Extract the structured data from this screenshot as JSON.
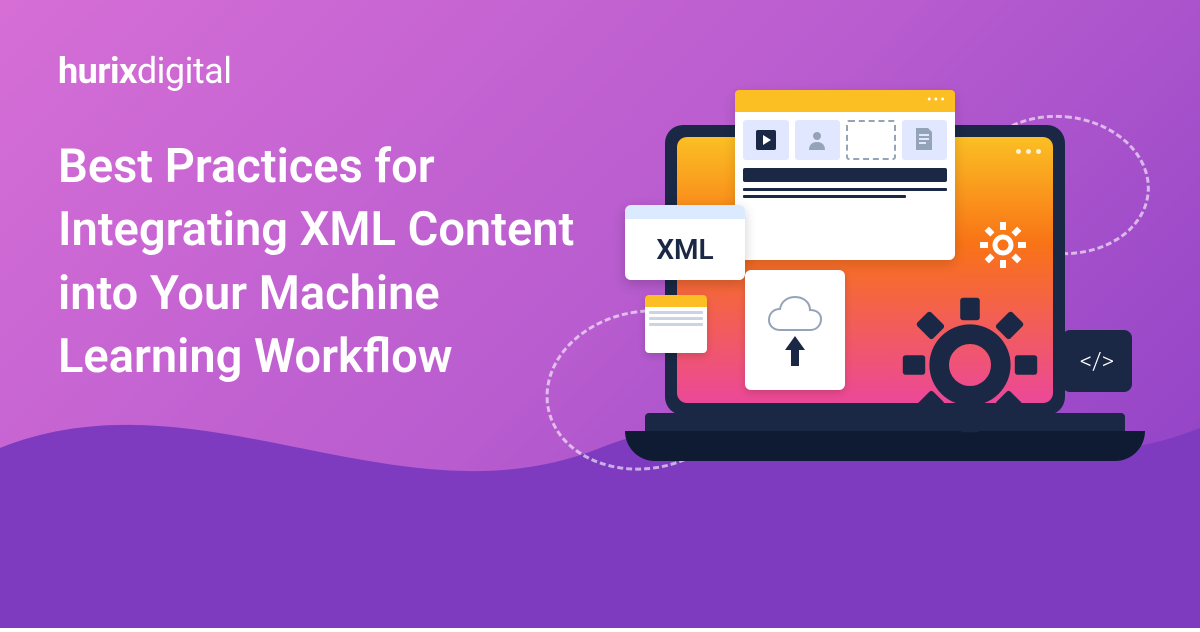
{
  "logo": {
    "brand": "hurix",
    "suffix": "digital"
  },
  "title": "Best Practices for Integrating XML Content into Your Machine Learning Workflow",
  "cards": {
    "xml_label": "XML",
    "code_label": "</>"
  },
  "icons": {
    "play": "play-icon",
    "user": "user-icon",
    "doc": "document-icon",
    "cloud": "cloud-upload-icon",
    "gear": "gear-icon",
    "code": "code-icon"
  },
  "colors": {
    "bg_start": "#d66ed6",
    "bg_end": "#8b3fc5",
    "navy": "#1a2845",
    "amber": "#fbbf24",
    "orange": "#f97316",
    "pink": "#ec4899"
  }
}
